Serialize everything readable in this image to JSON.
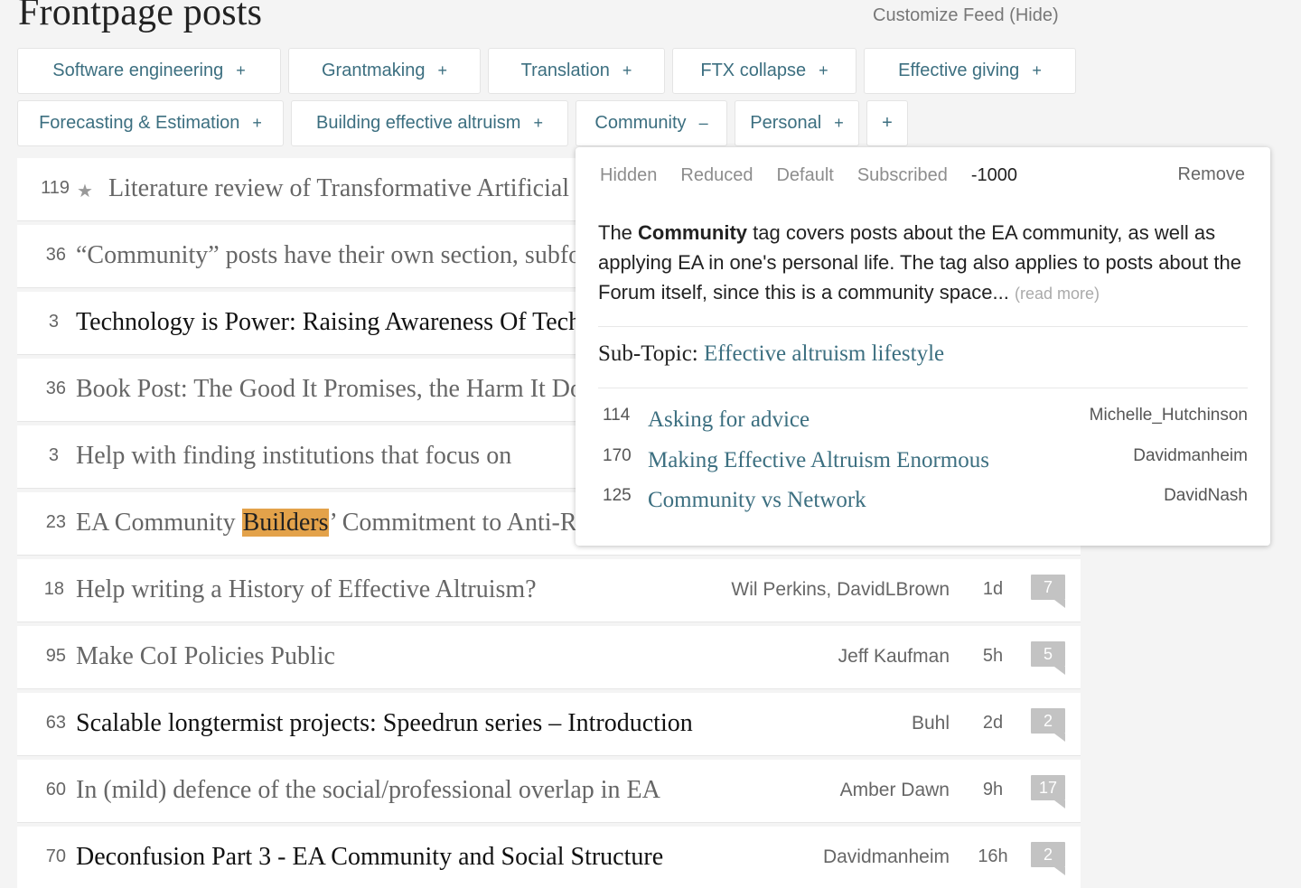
{
  "header": {
    "title": "Frontpage posts",
    "customize": "Customize Feed (Hide)"
  },
  "tags": {
    "row1": [
      {
        "label": "Software engineering",
        "mod": "+"
      },
      {
        "label": "Grantmaking",
        "mod": "+"
      },
      {
        "label": "Translation",
        "mod": "+"
      },
      {
        "label": "FTX collapse",
        "mod": "+"
      },
      {
        "label": "Effective giving",
        "mod": "+"
      }
    ],
    "row2": [
      {
        "label": "Forecasting & Estimation",
        "mod": "+"
      },
      {
        "label": "Building effective altruism",
        "mod": "+"
      },
      {
        "label": "Community",
        "mod": "–"
      },
      {
        "label": "Personal",
        "mod": "+"
      }
    ],
    "add": "+"
  },
  "posts": [
    {
      "karma": "119",
      "title": "Literature review of Transformative Artificial Intelligence timelines",
      "author": "",
      "age": "",
      "comments": "",
      "curated": true
    },
    {
      "karma": "36",
      "title": "“Community” posts have their own section, subforums are closing, and more",
      "author": "",
      "age": "",
      "comments": ""
    },
    {
      "karma": "3",
      "title": "Technology is Power: Raising Awareness Of Technological Risks",
      "author": "",
      "age": "",
      "comments": ""
    },
    {
      "karma": "36",
      "title": "Book Post: The Good It Promises, the Harm It Does",
      "author": "",
      "age": "",
      "comments": ""
    },
    {
      "karma": "3",
      "title": "Help with finding institutions that focus on",
      "author": "",
      "age": "",
      "comments": ""
    },
    {
      "karma": "23",
      "title_pre": "EA Community ",
      "title_hl": "Builders",
      "title_post": "’ Commitment to Anti-Racism",
      "author": "",
      "age": "",
      "comments": ""
    },
    {
      "karma": "18",
      "title": "Help writing a History of Effective Altruism?",
      "author": "Wil Perkins, DavidLBrown",
      "age": "1d",
      "comments": "7"
    },
    {
      "karma": "95",
      "title": "Make CoI Policies Public",
      "author": "Jeff Kaufman",
      "age": "5h",
      "comments": "5"
    },
    {
      "karma": "63",
      "title": "Scalable longtermist projects: Speedrun series – Introduction",
      "author": "Buhl",
      "age": "2d",
      "comments": "2"
    },
    {
      "karma": "60",
      "title": "In (mild) defence of the social/professional overlap in EA",
      "author": "Amber Dawn",
      "age": "9h",
      "comments": "17"
    },
    {
      "karma": "70",
      "title": "Deconfusion Part 3 - EA Community and Social Structure",
      "author": "Davidmanheim",
      "age": "16h",
      "comments": "2"
    }
  ],
  "popup": {
    "modes": [
      "Hidden",
      "Reduced",
      "Default",
      "Subscribed"
    ],
    "custom_value": "-1000",
    "remove": "Remove",
    "desc_pre": "The ",
    "desc_bold": "Community",
    "desc_post": " tag covers posts about the EA community, as well as applying EA in one's personal life. The tag also applies to posts about the Forum itself, since this is a community space...",
    "read_more": "(read more)",
    "subtopic_label": "Sub-Topic: ",
    "subtopic_link": "Effective altruism lifestyle",
    "related": [
      {
        "karma": "114",
        "title": "Asking for advice",
        "author": "Michelle_Hutchinson"
      },
      {
        "karma": "170",
        "title": "Making Effective Altruism Enormous",
        "author": "Davidmanheim"
      },
      {
        "karma": "125",
        "title": "Community vs Network",
        "author": "DavidNash"
      }
    ]
  },
  "colors": {
    "link": "#3c6f80",
    "highlight": "#e3a24a",
    "comment_badge": "#c3c3c3"
  }
}
